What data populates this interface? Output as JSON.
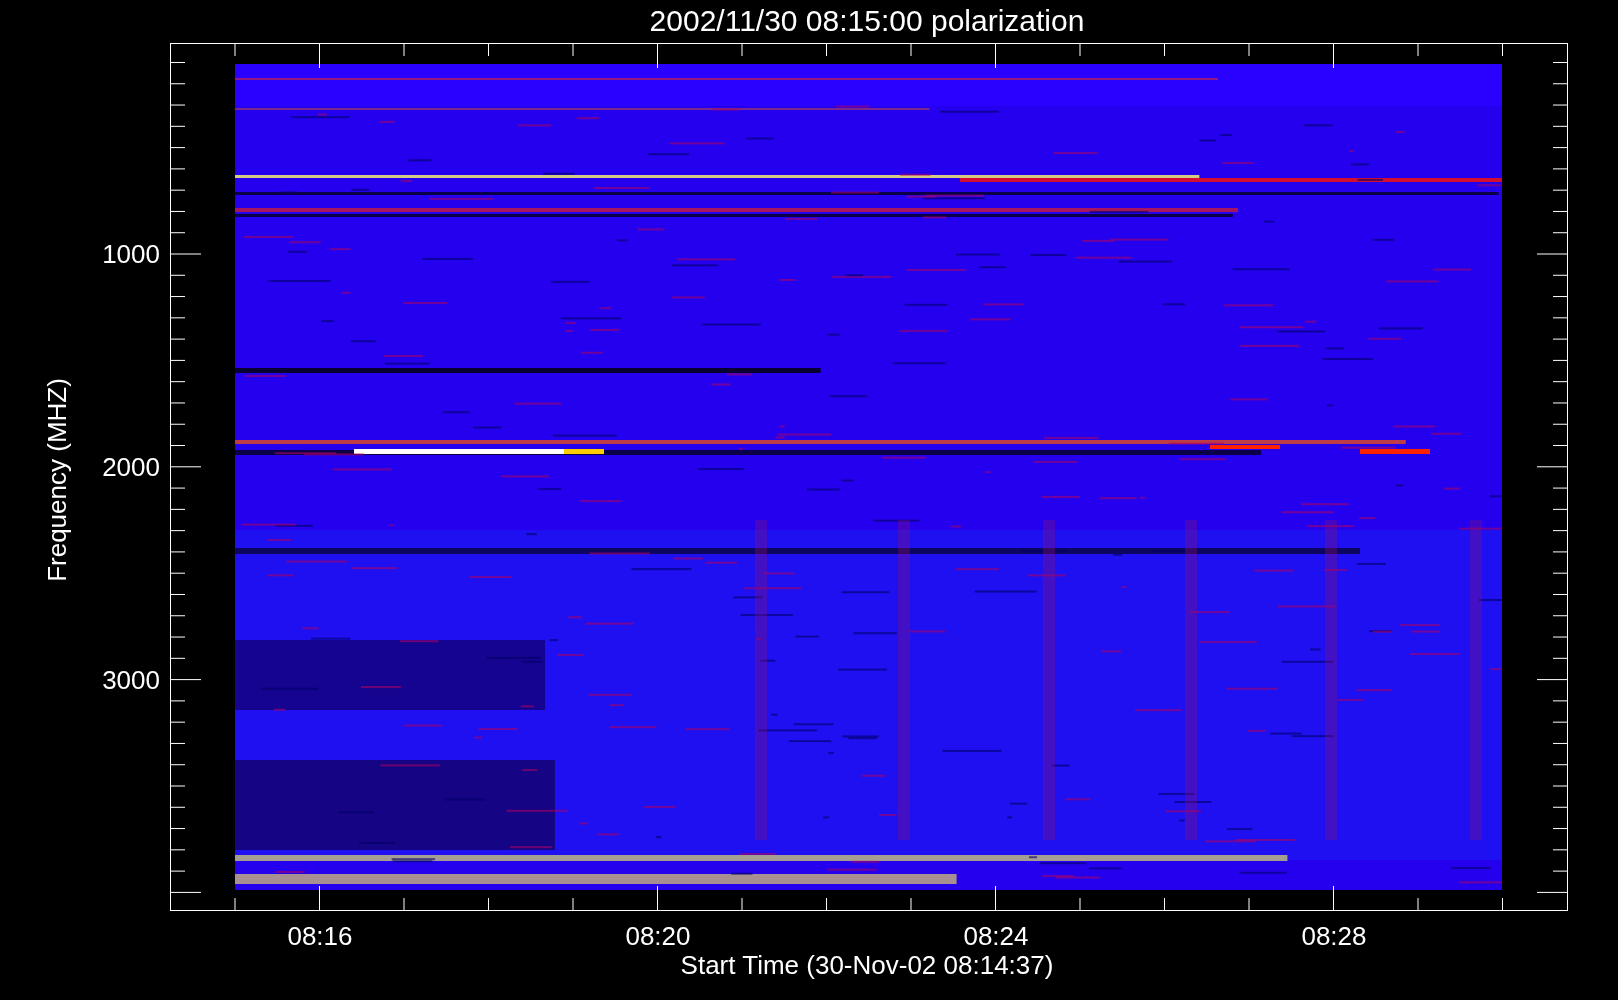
{
  "title": "2002/11/30 08:15:00 polarization",
  "y_axis": {
    "label": "Frequency (MHZ)",
    "ticks": [
      "1000",
      "2000",
      "3000"
    ]
  },
  "x_axis": {
    "label": "Start Time (30-Nov-02 08:14:37)",
    "ticks": [
      "08:16",
      "08:20",
      "08:24",
      "08:28"
    ]
  }
}
